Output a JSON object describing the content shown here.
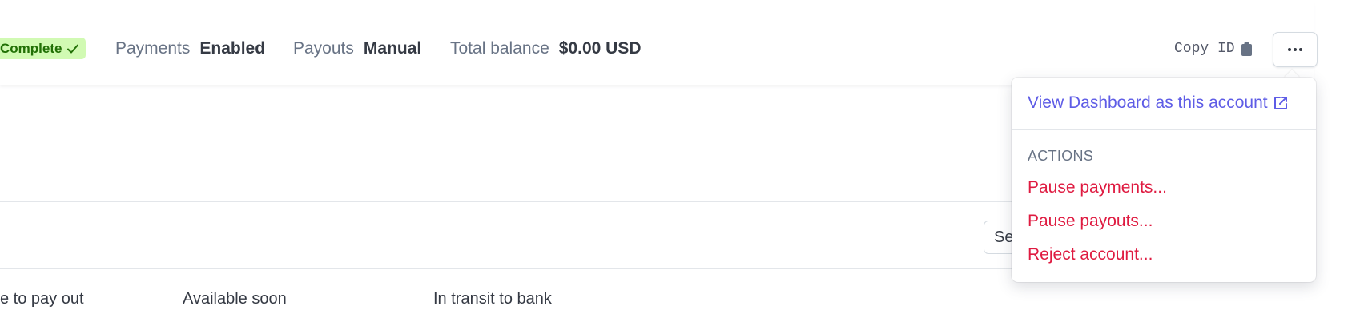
{
  "header": {
    "status_badge": "Complete",
    "payments": {
      "label": "Payments",
      "value": "Enabled"
    },
    "payouts": {
      "label": "Payouts",
      "value": "Manual"
    },
    "balance": {
      "label": "Total balance",
      "value": "$0.00 USD"
    },
    "copy_id_label": "Copy ID",
    "more_icon": "ellipsis-icon"
  },
  "toolbar": {
    "partial_button_label": "Se"
  },
  "balance_columns": [
    "e to pay out",
    "Available soon",
    "In transit to bank"
  ],
  "menu": {
    "view_dashboard": "View Dashboard as this account",
    "actions_heading": "ACTIONS",
    "items": [
      "Pause payments...",
      "Pause payouts...",
      "Reject account..."
    ]
  },
  "colors": {
    "accent": "#5e5ce6",
    "danger": "#df1b41",
    "success_bg": "#d1fab3",
    "success_text": "#217005"
  }
}
